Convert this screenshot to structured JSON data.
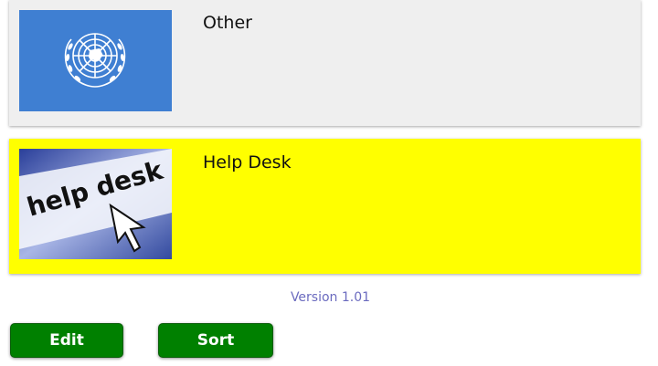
{
  "cards": [
    {
      "title": "Other",
      "image_icon": "united-nations-emblem",
      "background": "#efefef"
    },
    {
      "title": "Help Desk",
      "image_icon": "help-desk-cursor",
      "image_text": "help desk",
      "background": "#ffff00"
    }
  ],
  "version": "Version 1.01",
  "buttons": {
    "edit_label": "Edit",
    "sort_label": "Sort"
  },
  "colors": {
    "button_green": "#008000",
    "un_blue": "#3f7fd2",
    "version_text": "#6b6bbf"
  }
}
